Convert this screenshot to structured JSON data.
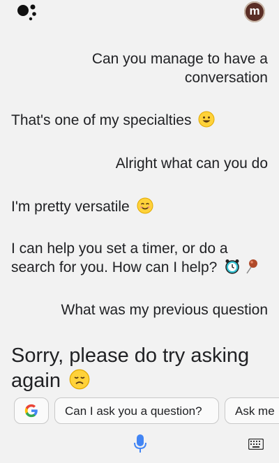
{
  "header": {
    "avatar_initial": "m"
  },
  "conversation": [
    {
      "role": "user",
      "text": "Can you manage to have a"
    },
    {
      "role": "user",
      "text": "conversation"
    },
    {
      "role": "assistant",
      "text": "That's one of my specialties"
    },
    {
      "role": "user",
      "text": "Alright what can you do"
    },
    {
      "role": "assistant",
      "text": "I'm pretty versatile"
    },
    {
      "role": "assistant",
      "text": "I can help you set a timer, or do a"
    },
    {
      "role": "assistant",
      "text": "search for you. How can I help?"
    },
    {
      "role": "user",
      "text": "What was my previous question"
    }
  ],
  "response": {
    "line1": "Sorry, please do try asking",
    "line2": "again"
  },
  "suggestions": {
    "chips": [
      "Can I ask you a question?",
      "Ask me"
    ]
  },
  "icons": {
    "assistant": "google-assistant-dots-icon",
    "search_chip": "google-g-icon",
    "mic": "microphone-icon",
    "keyboard": "keyboard-icon"
  }
}
